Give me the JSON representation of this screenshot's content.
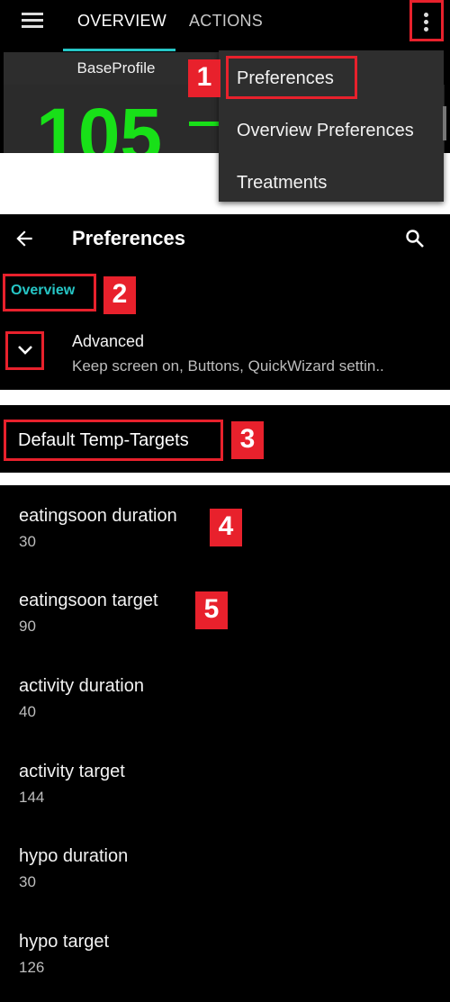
{
  "tabs": {
    "overview": "OVERVIEW",
    "actions": "ACTIONS"
  },
  "overview_screen": {
    "profile": "BaseProfile",
    "bg_value": "105"
  },
  "overflow_menu": {
    "items": [
      "Preferences",
      "Overview Preferences",
      "Treatments"
    ]
  },
  "preferences": {
    "title": "Preferences",
    "category": "Overview",
    "advanced": {
      "title": "Advanced",
      "summary": "Keep screen on, Buttons, QuickWizard settin.."
    }
  },
  "section": {
    "title": "Default Temp-Targets"
  },
  "temp_targets": [
    {
      "label": "eatingsoon duration",
      "value": "30"
    },
    {
      "label": "eatingsoon target",
      "value": "90"
    },
    {
      "label": "activity duration",
      "value": "40"
    },
    {
      "label": "activity target",
      "value": "144"
    },
    {
      "label": "hypo duration",
      "value": "30"
    },
    {
      "label": "hypo target",
      "value": "126"
    }
  ],
  "step_numbers": [
    "1",
    "2",
    "3",
    "4",
    "5"
  ],
  "colors": {
    "highlight": "#e8212c",
    "accent": "#26c6c6",
    "bg_green": "#18e018"
  },
  "icons": [
    "menu-icon",
    "more-vert-icon",
    "back-arrow-icon",
    "search-icon",
    "chevron-down-icon"
  ]
}
